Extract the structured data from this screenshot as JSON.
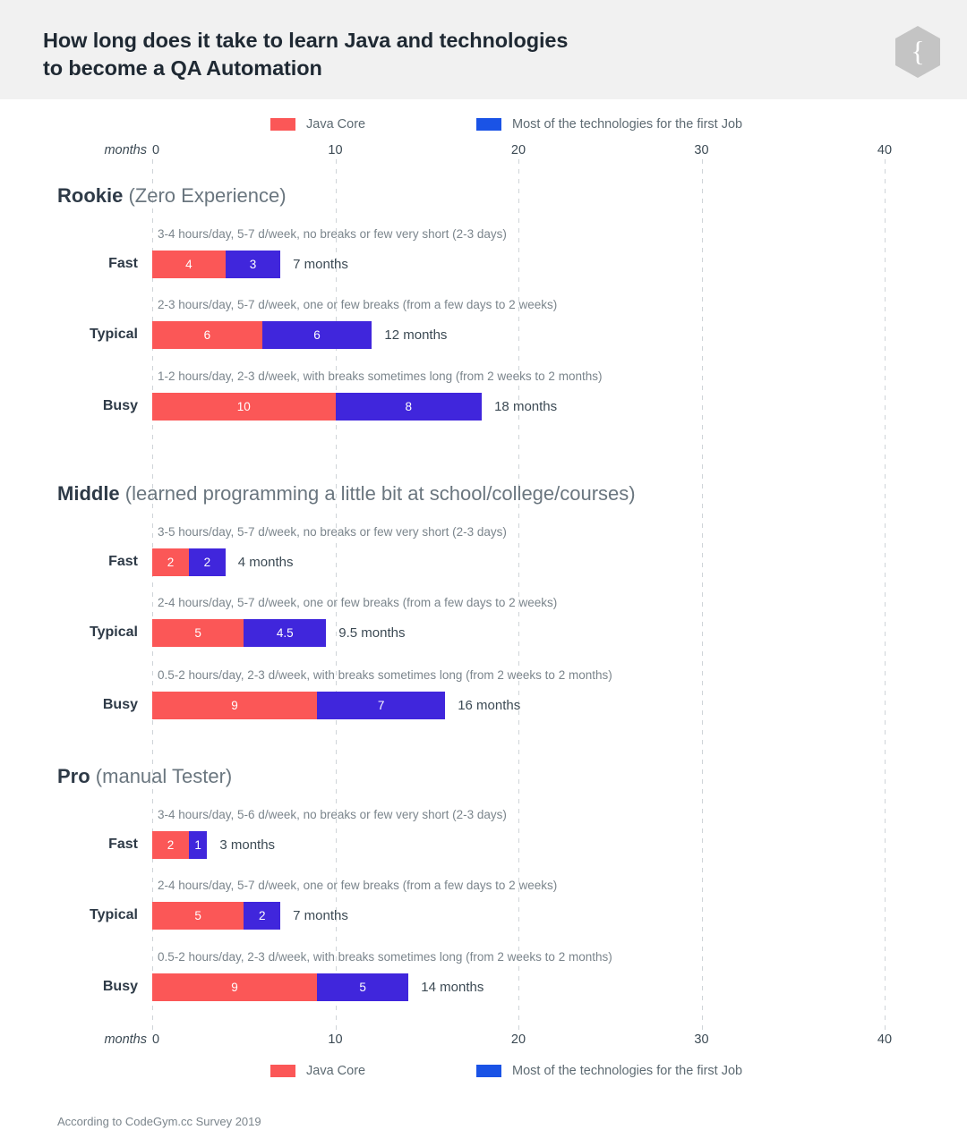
{
  "header": {
    "title_line1": "How long does it take to learn Java and technologies",
    "title_line2": "to become a QA Automation",
    "logo_icon": "curly-brace-hexagon-logo",
    "band_color": "#F1F1F1"
  },
  "legend": {
    "items": [
      {
        "label": "Java Core",
        "color": "#FB5757",
        "icon": "legend-swatch-red"
      },
      {
        "label": "Most of the technologies for the first Job",
        "color": "#1A53E6",
        "icon": "legend-swatch-blue"
      }
    ]
  },
  "axis": {
    "name": "months",
    "ticks": [
      "0",
      "10",
      "20",
      "30",
      "40"
    ]
  },
  "footer": {
    "note": "According to CodeGym.cc Survey 2019"
  },
  "colors": {
    "java_core": "#FB5757",
    "technologies": "#4026DC",
    "legend_blue": "#1A53E6",
    "gridline": "#CFD4D8",
    "text_dark": "#2E3A47",
    "text_muted": "#7B858C"
  },
  "chart_data": {
    "type": "bar",
    "orientation": "horizontal",
    "stacked": true,
    "title": "How long does it take to learn Java and technologies to become a QA Automation",
    "xlabel": "months",
    "ylabel": "",
    "xlim": [
      0,
      40
    ],
    "xticks": [
      0,
      10,
      20,
      30,
      40
    ],
    "grid": "vertical-dashed",
    "legend_position": "top-and-bottom-center",
    "series": [
      {
        "name": "Java Core",
        "color": "#FB5757"
      },
      {
        "name": "Most of the technologies for the first Job",
        "color": "#4026DC"
      }
    ],
    "groups": [
      {
        "name": "Rookie",
        "detail": "(Zero Experience)",
        "rows": [
          {
            "label": "Fast",
            "description": "3-4 hours/day, 5-7 d/week, no breaks or few very short (2-3 days)",
            "java_core": 4,
            "technologies": 3,
            "java_core_label": "4",
            "technologies_label": "3",
            "total_label": "7 months"
          },
          {
            "label": "Typical",
            "description": "2-3 hours/day, 5-7 d/week, one or few breaks (from a few days to 2 weeks)",
            "java_core": 6,
            "technologies": 6,
            "java_core_label": "6",
            "technologies_label": "6",
            "total_label": "12 months"
          },
          {
            "label": "Busy",
            "description": "1-2 hours/day, 2-3 d/week, with breaks sometimes long (from 2 weeks to 2 months)",
            "java_core": 10,
            "technologies": 8,
            "java_core_label": "10",
            "technologies_label": "8",
            "total_label": "18 months"
          }
        ]
      },
      {
        "name": "Middle",
        "detail": "(learned programming a little bit at school/college/courses)",
        "rows": [
          {
            "label": "Fast",
            "description": "3-5 hours/day, 5-7 d/week, no breaks or few very short (2-3 days)",
            "java_core": 2,
            "technologies": 2,
            "java_core_label": "2",
            "technologies_label": "2",
            "total_label": "4 months"
          },
          {
            "label": "Typical",
            "description": "2-4 hours/day, 5-7 d/week, one or few breaks (from a few days to 2 weeks)",
            "java_core": 5,
            "technologies": 4.5,
            "java_core_label": "5",
            "technologies_label": "4.5",
            "total_label": "9.5 months"
          },
          {
            "label": "Busy",
            "description": "0.5-2 hours/day, 2-3 d/week, with breaks sometimes long (from 2 weeks to 2 months)",
            "java_core": 9,
            "technologies": 7,
            "java_core_label": "9",
            "technologies_label": "7",
            "total_label": "16 months"
          }
        ]
      },
      {
        "name": "Pro",
        "detail": "(manual Tester)",
        "rows": [
          {
            "label": "Fast",
            "description": "3-4 hours/day, 5-6 d/week, no breaks or few very short (2-3 days)",
            "java_core": 2,
            "technologies": 1,
            "java_core_label": "2",
            "technologies_label": "1",
            "total_label": "3 months"
          },
          {
            "label": "Typical",
            "description": "2-4 hours/day, 5-7 d/week, one or few breaks (from a few days to 2 weeks)",
            "java_core": 5,
            "technologies": 2,
            "java_core_label": "5",
            "technologies_label": "2",
            "total_label": "7 months"
          },
          {
            "label": "Busy",
            "description": "0.5-2 hours/day, 2-3 d/week, with breaks sometimes long (from 2 weeks to 2 months)",
            "java_core": 9,
            "technologies": 5,
            "java_core_label": "9",
            "technologies_label": "5",
            "total_label": "14 months"
          }
        ]
      }
    ]
  }
}
